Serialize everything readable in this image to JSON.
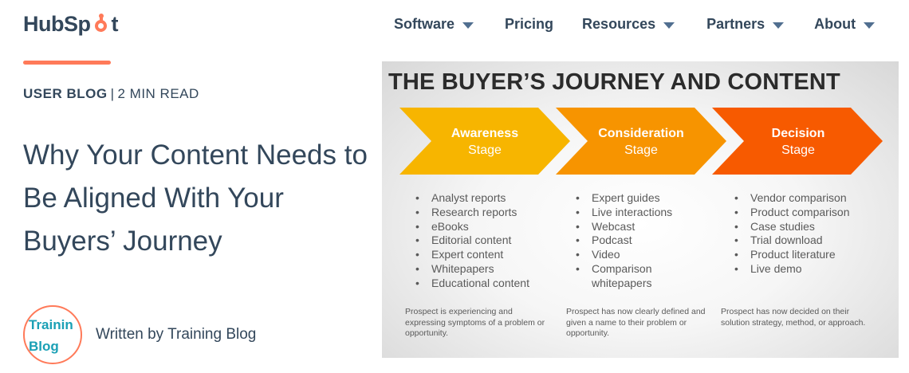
{
  "brand": {
    "logo_prefix": "HubSp",
    "logo_suffix": "t",
    "accent_color": "#ff7a59"
  },
  "nav": {
    "items": [
      {
        "label": "Software",
        "has_dropdown": true
      },
      {
        "label": "Pricing",
        "has_dropdown": false
      },
      {
        "label": "Resources",
        "has_dropdown": true
      },
      {
        "label": "Partners",
        "has_dropdown": true
      },
      {
        "label": "About",
        "has_dropdown": true
      }
    ]
  },
  "article": {
    "category": "User Blog",
    "separator": "|",
    "read_time": "2 min read",
    "title": "Why Your Content Needs to Be Aligned With Your Buyers’ Journey",
    "author_prefix": "Written by",
    "author_name": "Training Blog",
    "avatar_line1": "Trainin",
    "avatar_line2": "Blog"
  },
  "infographic": {
    "title": "THE BUYER’S JOURNEY AND CONTENT",
    "stages": [
      {
        "name": "Awareness",
        "stage": "Stage",
        "color": "#f7b500",
        "items": [
          "Analyst reports",
          "Research reports",
          "eBooks",
          "Editorial content",
          "Expert content",
          "Whitepapers",
          "Educational content"
        ],
        "description": "Prospect is experiencing and expressing symptoms of a problem or opportunity."
      },
      {
        "name": "Consideration",
        "stage": "Stage",
        "color": "#f79400",
        "items": [
          "Expert guides",
          "Live interactions",
          "Webcast",
          "Podcast",
          "Video",
          "Comparison",
          "whitepapers"
        ],
        "description": "Prospect has now clearly defined and given a name to their problem or opportunity."
      },
      {
        "name": "Decision",
        "stage": "Stage",
        "color": "#f75a00",
        "items": [
          "Vendor comparison",
          "Product comparison",
          "Case studies",
          "Trial download",
          "Product literature",
          "Live demo"
        ],
        "description": "Prospect has now decided on their solution strategy, method, or approach."
      }
    ]
  }
}
